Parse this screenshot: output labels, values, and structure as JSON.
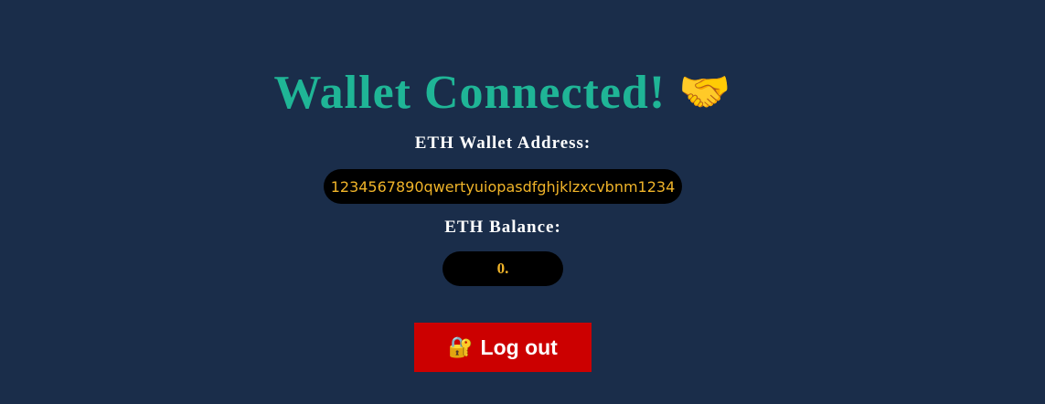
{
  "header": {
    "title": "Wallet Connected!",
    "title_emoji": "🤝",
    "title_icon": "handshake-icon"
  },
  "wallet": {
    "address_label": "ETH Wallet Address:",
    "address": "1234567890qwertyuiopasdfghjklzxcvbnm1234",
    "balance_label": "ETH Balance:",
    "balance": "0."
  },
  "logout": {
    "icon_emoji": "🔐",
    "icon": "lock-with-key-icon",
    "label": "Log out"
  },
  "colors": {
    "background": "#1a2d4a",
    "title": "#1fb596",
    "value_text": "#f0b429",
    "pill_background": "#000000",
    "logout_background": "#cc0000"
  }
}
